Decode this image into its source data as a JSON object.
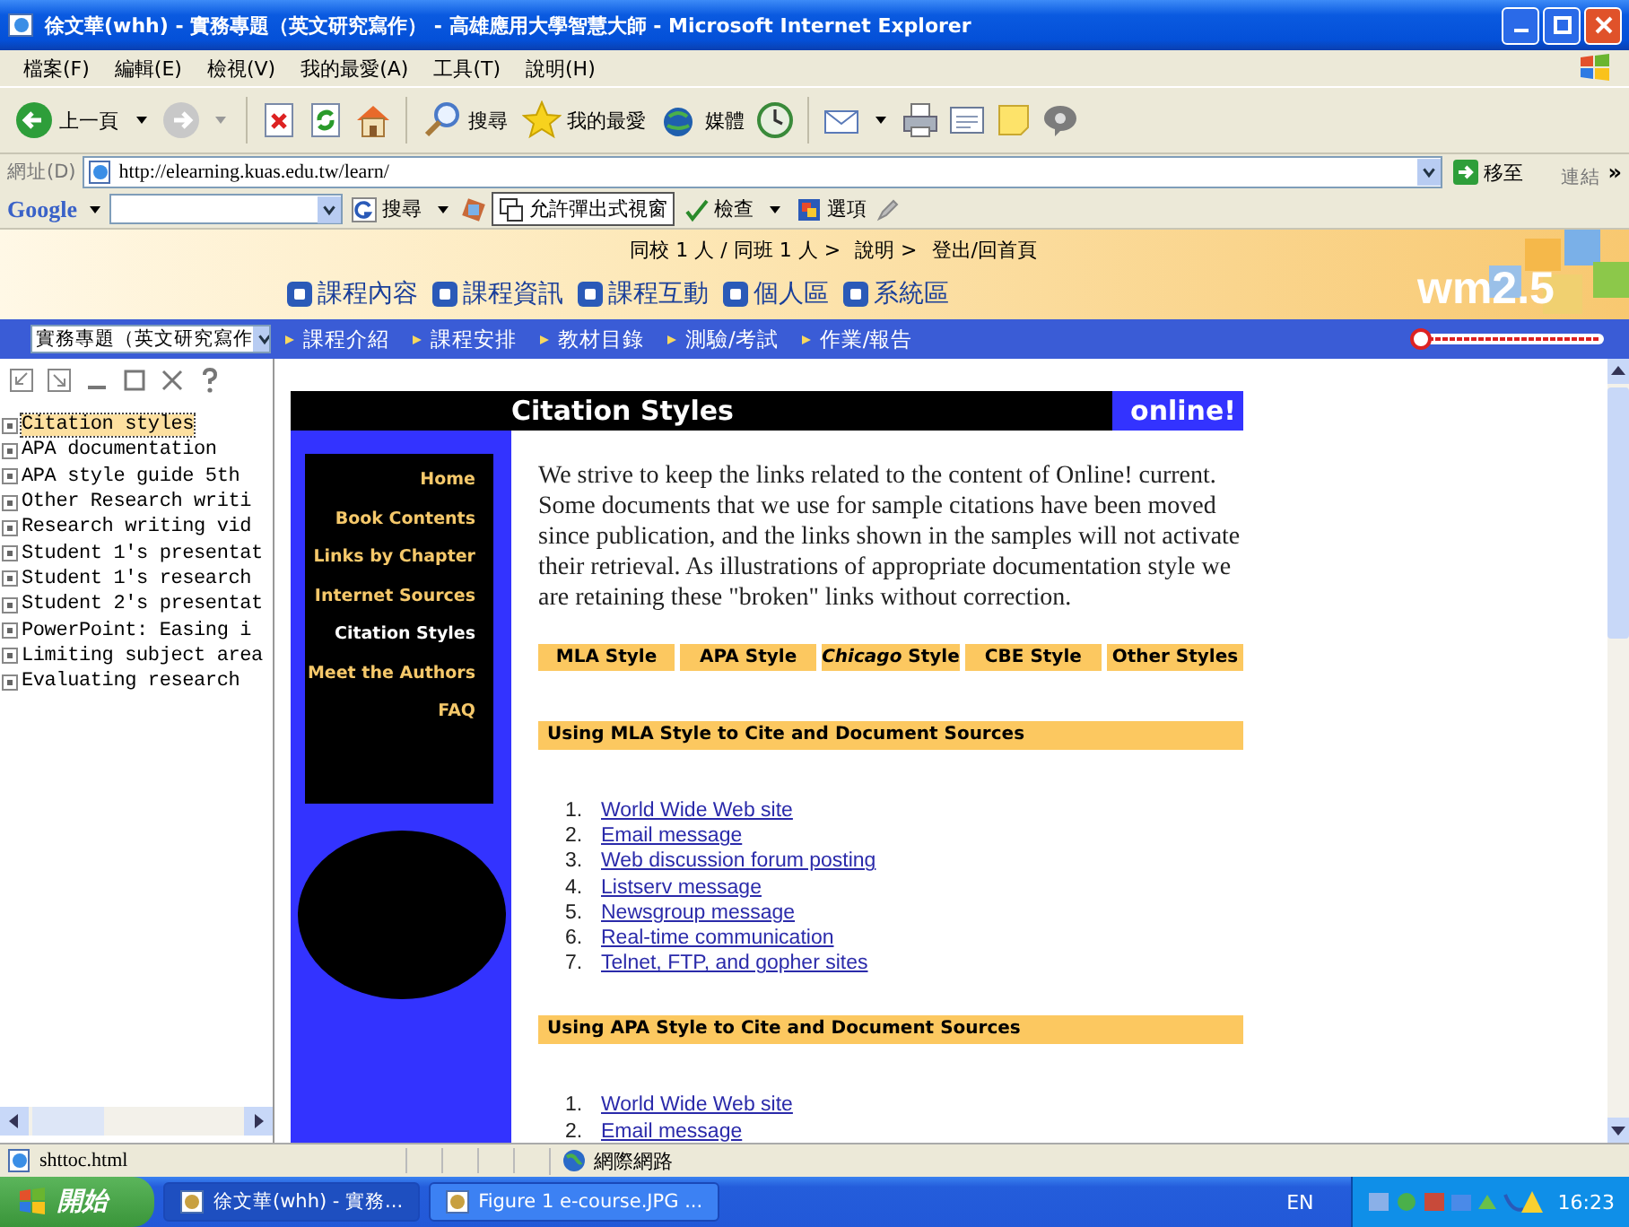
{
  "window": {
    "title": "徐文華(whh) - 實務專題（英文研究寫作） - 高雄應用大學智慧大師 - Microsoft Internet Explorer"
  },
  "menu_bar": [
    "檔案(F)",
    "編輯(E)",
    "檢視(V)",
    "我的最愛(A)",
    "工具(T)",
    "說明(H)"
  ],
  "toolbar": {
    "back": "上一頁",
    "search": "搜尋",
    "favorites": "我的最愛",
    "media": "媒體"
  },
  "address_bar": {
    "label": "網址(D)",
    "value": "http://elearning.kuas.edu.tw/learn/",
    "go": "移至",
    "links": "連結",
    "more": "»"
  },
  "google_bar": {
    "logo": "Google",
    "search": "搜尋",
    "popups": "允許彈出式視窗",
    "check": "檢查",
    "options": "選項"
  },
  "banner": {
    "top_links": [
      "同校 1 人 / 同班 1 人 >",
      "說明 >",
      "登出/回首頁"
    ],
    "tabs": [
      "課程內容",
      "課程資訊",
      "課程互動",
      "個人區",
      "系統區"
    ],
    "logo": "wm2.5"
  },
  "course_nav": {
    "course": "實務專題（英文研究寫作",
    "links": [
      "課程介紹",
      "課程安排",
      "教材目錄",
      "測驗/考試",
      "作業/報告"
    ]
  },
  "outline": [
    {
      "label": "Citation styles",
      "selected": true
    },
    {
      "label": "APA documentation",
      "selected": false
    },
    {
      "label": "APA style guide 5th",
      "selected": false
    },
    {
      "label": "Other Research writi",
      "selected": false
    },
    {
      "label": "Research writing vid",
      "selected": false
    },
    {
      "label": "Student 1's presentat",
      "selected": false
    },
    {
      "label": "Student 1's research",
      "selected": false
    },
    {
      "label": "Student 2's presentat",
      "selected": false
    },
    {
      "label": "PowerPoint: Easing i",
      "selected": false
    },
    {
      "label": "Limiting subject area",
      "selected": false
    },
    {
      "label": "Evaluating research",
      "selected": false
    }
  ],
  "page": {
    "title": "Citation Styles",
    "badge": "online!",
    "nav": [
      {
        "label": "Home",
        "selected": false
      },
      {
        "label": "Book Contents",
        "selected": false
      },
      {
        "label": "Links by Chapter",
        "selected": false
      },
      {
        "label": "Internet Sources",
        "selected": false
      },
      {
        "label": "Citation Styles",
        "selected": true
      },
      {
        "label": "Meet the Authors",
        "selected": false
      },
      {
        "label": "FAQ",
        "selected": false
      }
    ],
    "intro": "We strive to keep the links related to the content of Online! current. Some documents that we use for sample citations have been moved since publication, and the links shown in the samples will not activate their retrieval. As illustrations of appropriate documentation style we are retaining these \"broken\" links without correction.",
    "style_tabs": [
      "MLA Style",
      "APA Style",
      "*Chicago* Style",
      "CBE Style",
      "Other Styles"
    ],
    "sections": [
      {
        "heading": "Using MLA Style to Cite and Document Sources",
        "links": [
          {
            "number": "1.",
            "label": "World Wide Web site"
          },
          {
            "number": "2.",
            "label": "Email message"
          },
          {
            "number": "3.",
            "label": "Web discussion forum posting"
          },
          {
            "number": "4.",
            "label": "Listserv message"
          },
          {
            "number": "5.",
            "label": "Newsgroup message"
          },
          {
            "number": "6.",
            "label": "Real-time communication"
          },
          {
            "number": "7.",
            "label": "Telnet, FTP, and gopher sites"
          }
        ]
      },
      {
        "heading": "Using APA Style to Cite and Document Sources",
        "links": [
          {
            "number": "1.",
            "label": "World Wide Web site"
          },
          {
            "number": "2.",
            "label": "Email message"
          }
        ]
      }
    ]
  },
  "status_bar": {
    "text": "shttoc.html",
    "zone": "網際網路"
  },
  "taskbar": {
    "start": "開始",
    "tasks": [
      {
        "label": "徐文華(whh) - 實務...",
        "selected": true
      },
      {
        "label": "Figure 1 e-course.JPG ...",
        "selected": false
      }
    ],
    "language": "EN",
    "clock": "16:23"
  }
}
